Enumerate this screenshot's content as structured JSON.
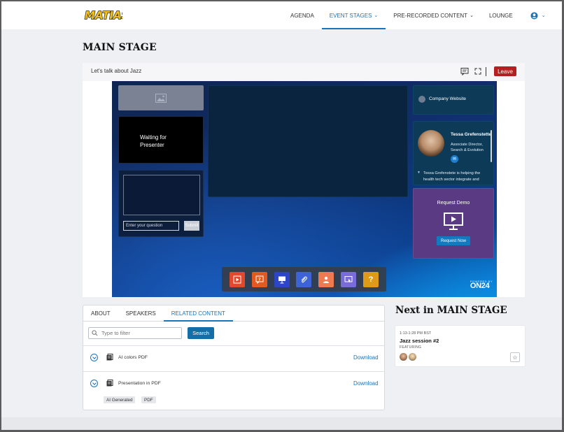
{
  "header": {
    "logo_text": "MATIAS",
    "nav": [
      {
        "label": "AGENDA",
        "dropdown": false,
        "active": false
      },
      {
        "label": "EVENT STAGES",
        "dropdown": true,
        "active": true
      },
      {
        "label": "PRE-RECORDED CONTENT",
        "dropdown": true,
        "active": false
      },
      {
        "label": "LOUNGE",
        "dropdown": false,
        "active": false
      }
    ],
    "account_icon": "user-circle-icon",
    "accent_color": "#1b73b8"
  },
  "page": {
    "title": "MAIN STAGE"
  },
  "stage_bar": {
    "session_title": "Let's talk about Jazz",
    "leave_label": "Leave",
    "leave_color": "#b3201f",
    "icons": [
      "chat-icon",
      "fullscreen-icon"
    ]
  },
  "stage": {
    "waiting_text": "Waiting for Presenter",
    "question_placeholder": "Enter your question",
    "submit_label": "Submit",
    "website_label": "Company Website",
    "speaker": {
      "name": "Tessa Grefenstette",
      "role": "Associate Director, Search & Evolution",
      "bio": "Tessa Grefenstete is helping the health tech sector integrate and"
    },
    "demo": {
      "title": "Request Demo",
      "button": "Request Now"
    },
    "dock": [
      {
        "icon": "media-player-icon",
        "color": "#e2492c"
      },
      {
        "icon": "qa-icon",
        "color": "#e35a21"
      },
      {
        "icon": "slides-icon",
        "color": "#2d46c8"
      },
      {
        "icon": "resources-icon",
        "color": "#3d63d6"
      },
      {
        "icon": "speaker-bio-icon",
        "color": "#ee7a52"
      },
      {
        "icon": "screen-share-icon",
        "color": "#7a6cd8"
      },
      {
        "icon": "help-icon",
        "color": "#e09a1a",
        "text": "?"
      }
    ],
    "brand": "ON24",
    "brand_tagline": "POWERED BY"
  },
  "content_tabs": {
    "tabs": [
      {
        "label": "ABOUT",
        "active": false
      },
      {
        "label": "SPEAKERS",
        "active": false
      },
      {
        "label": "RELATED CONTENT",
        "active": true
      }
    ],
    "filter_placeholder": "Type to filter",
    "search_label": "Search",
    "items": [
      {
        "name": "AI colors PDF",
        "action": "Download",
        "tags": []
      },
      {
        "name": "Presentation in PDF",
        "action": "Download",
        "tags": [
          "AI Generated",
          "PDF"
        ]
      }
    ]
  },
  "next": {
    "heading": "Next in MAIN STAGE",
    "card": {
      "time": "1:13-1:28 PM BST",
      "title": "Jazz session #2",
      "featuring": "FEATURING"
    }
  }
}
